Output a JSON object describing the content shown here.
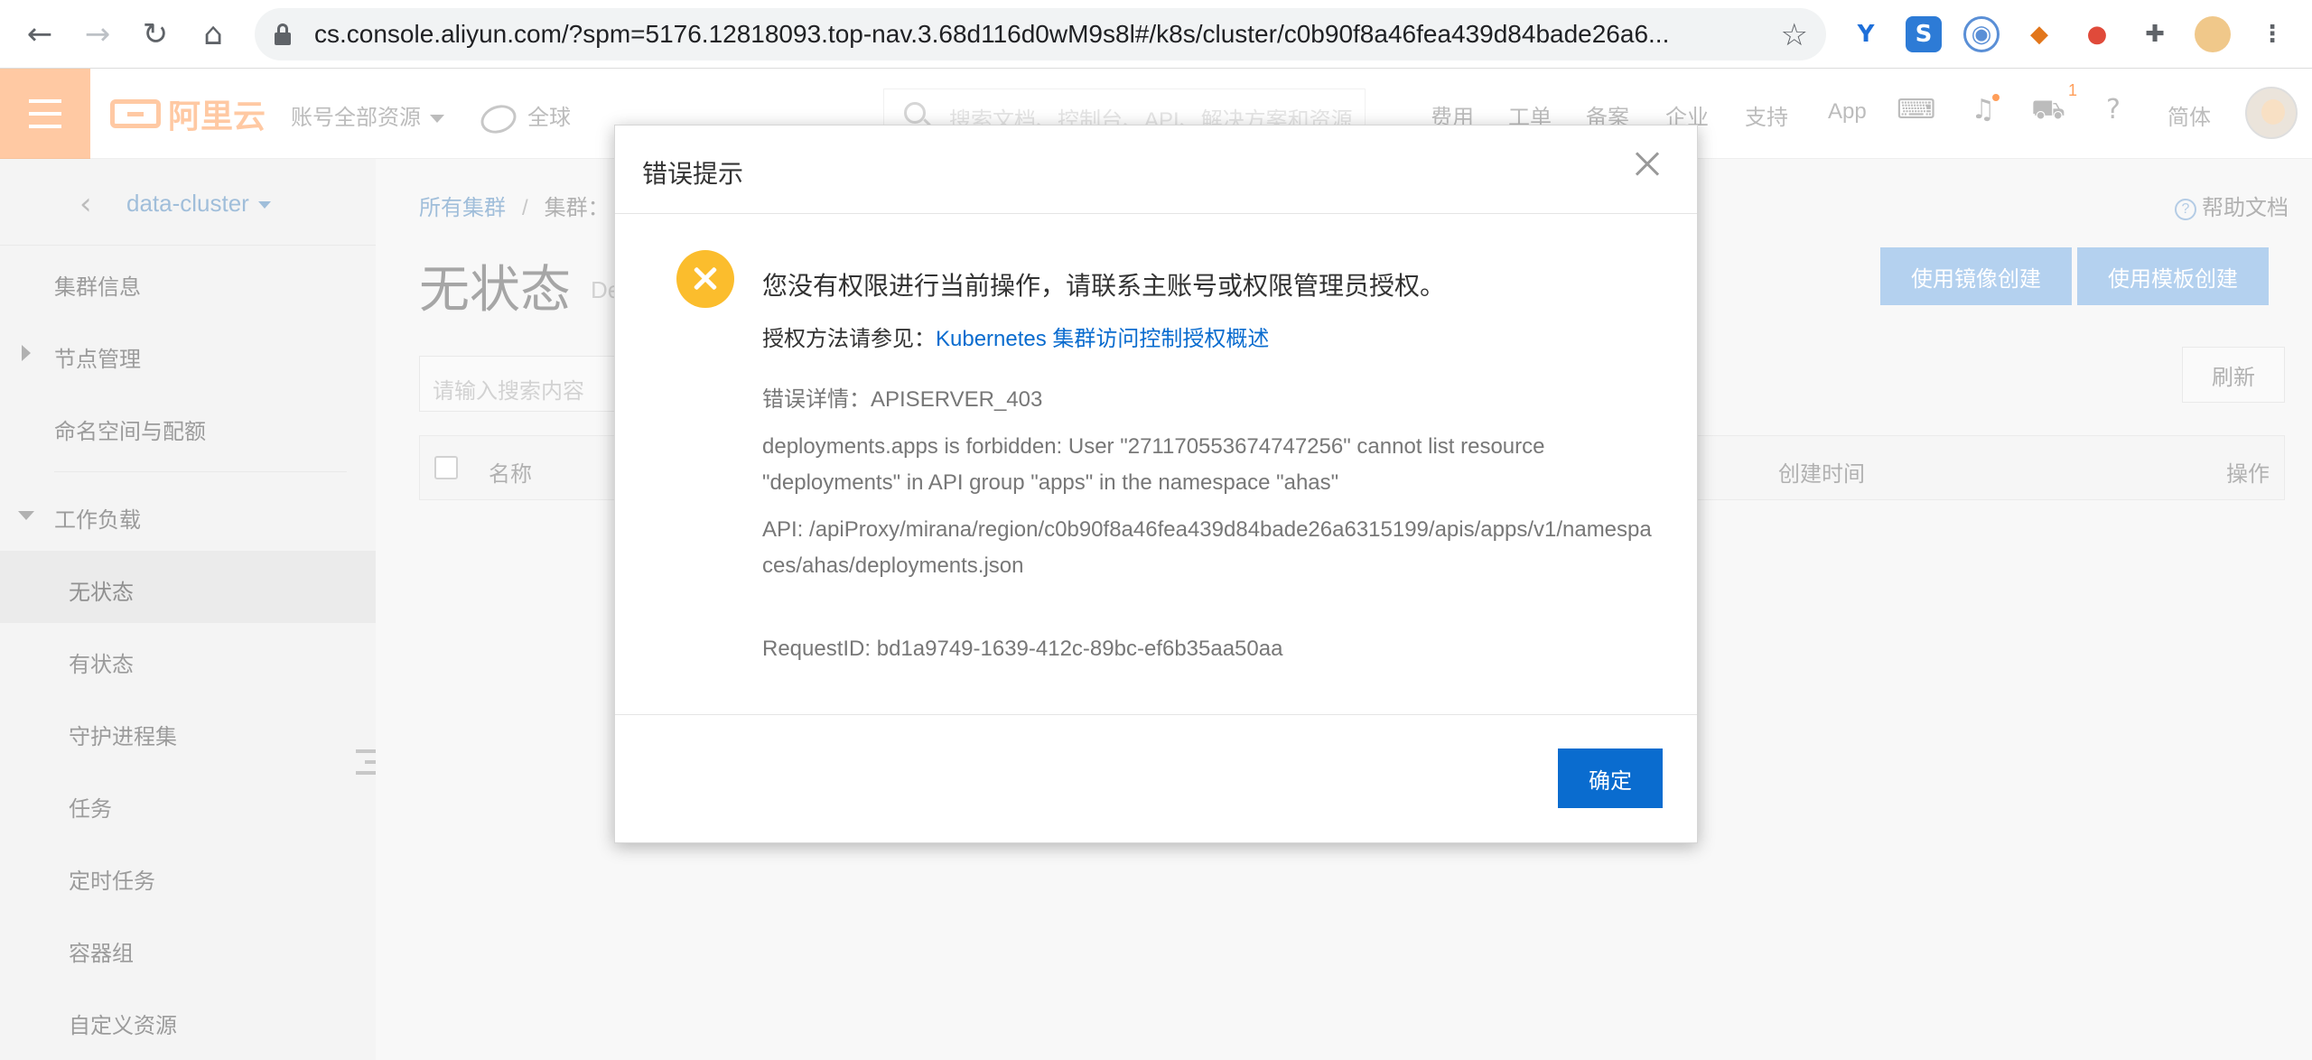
{
  "browser": {
    "url": "cs.console.aliyun.com/?spm=5176.12818093.top-nav.3.68d116d0wM9s8l#/k8s/cluster/c0b90f8a46fea439d84bade26a6...",
    "back_icon": "back-arrow-icon",
    "forward_icon": "forward-arrow-icon",
    "reload_icon": "reload-icon",
    "home_icon": "home-icon"
  },
  "header": {
    "logo": "阿里云",
    "account_resources": "账号全部资源",
    "region": "全球",
    "search_placeholder": "搜索文档、控制台、API、解决方案和资源",
    "links": [
      "费用",
      "工单",
      "备案",
      "企业",
      "支持",
      "App"
    ],
    "cart_count": "1",
    "language": "简体",
    "accent_color": "#ff6a00"
  },
  "sidebar": {
    "cluster_name": "data-cluster",
    "items": [
      {
        "label": "集群信息"
      },
      {
        "label": "节点管理"
      },
      {
        "label": "命名空间与配额"
      },
      {
        "label": "工作负载"
      },
      {
        "label": "无状态"
      },
      {
        "label": "有状态"
      },
      {
        "label": "守护进程集"
      },
      {
        "label": "任务"
      },
      {
        "label": "定时任务"
      },
      {
        "label": "容器组"
      },
      {
        "label": "自定义资源"
      }
    ]
  },
  "main": {
    "breadcrumb_all": "所有集群",
    "breadcrumb_sep": "/",
    "breadcrumb_cluster": "集群：",
    "help": "帮助文档",
    "title": "无状态",
    "subtitle": "De",
    "create_image_btn": "使用镜像创建",
    "create_template_btn": "使用模板创建",
    "search_placeholder": "请输入搜索内容",
    "refresh": "刷新",
    "columns": [
      "名称",
      "创建时间",
      "操作"
    ]
  },
  "dialog": {
    "title": "错误提示",
    "message": "您没有权限进行当前操作，请联系主账号或权限管理员授权。",
    "auth_prefix": "授权方法请参见：",
    "auth_link": "Kubernetes 集群访问控制授权概述",
    "error_detail": "错误详情：APISERVER_403",
    "forbidden": "deployments.apps is forbidden: User \"271170553674747256\" cannot list resource \"deployments\" in API group \"apps\" in the namespace \"ahas\"",
    "api": "API: /apiProxy/mirana/region/c0b90f8a46fea439d84bade26a6315199/apis/apps/v1/namespaces/ahas/deployments.json",
    "request_id": "RequestID: bd1a9749-1639-412c-89bc-ef6b35aa50aa",
    "ok": "确定",
    "primary_color": "#0a6ccf",
    "warning_color": "#fbbd2d"
  }
}
